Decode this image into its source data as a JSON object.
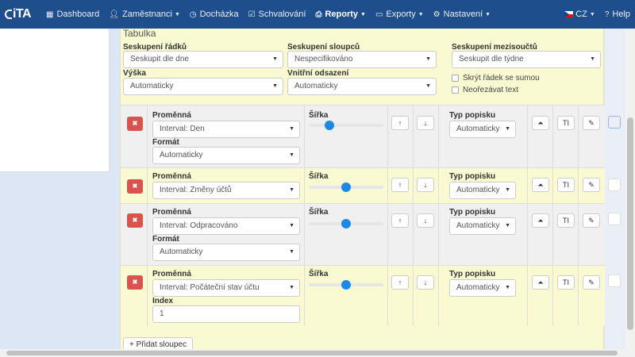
{
  "navbar": {
    "logo_text": "iTA",
    "items": [
      {
        "label": "Dashboard",
        "icon": "grid-icon"
      },
      {
        "label": "Zaměstnanci",
        "icon": "user-icon",
        "dropdown": true
      },
      {
        "label": "Docházka",
        "icon": "clock-icon"
      },
      {
        "label": "Schvalování",
        "icon": "check-square-icon"
      },
      {
        "label": "Reporty",
        "icon": "print-icon",
        "dropdown": true,
        "active": true
      },
      {
        "label": "Exporty",
        "icon": "folder-icon",
        "dropdown": true
      },
      {
        "label": "Nastavení",
        "icon": "gear-icon",
        "dropdown": true
      }
    ],
    "language": "CZ",
    "help": "Help"
  },
  "table_settings": {
    "section_title": "Tabulka",
    "row_grouping": {
      "label": "Seskupení řádků",
      "value": "Seskupit dle dne"
    },
    "column_grouping": {
      "label": "Seskupení sloupců",
      "value": "Nespecifikováno"
    },
    "subtotal_grouping": {
      "label": "Seskupení mezisoučtů",
      "value": "Seskupit dle týdne"
    },
    "height": {
      "label": "Výška",
      "value": "Automaticky"
    },
    "padding": {
      "label": "Vnitřní odsazení",
      "value": "Automaticky"
    },
    "hide_sum_row": "Skrýt řádek se sumou",
    "no_truncate": "Neořezávat text"
  },
  "columns": [
    {
      "variable_label": "Proměnná",
      "variable_value": "Interval: Den",
      "extra_label": "Formát",
      "extra_value": "Automaticky",
      "extra_type": "select",
      "width_label": "Šířka",
      "width_value": 0.28,
      "caption_label": "Typ popisku",
      "caption_value": "Automaticky"
    },
    {
      "variable_label": "Proměnná",
      "variable_value": "Interval: Změny účtů",
      "width_label": "Šířka",
      "width_value": 0.5,
      "caption_label": "Typ popisku",
      "caption_value": "Automaticky"
    },
    {
      "variable_label": "Proměnná",
      "variable_value": "Interval: Odpracováno",
      "extra_label": "Formát",
      "extra_value": "Automaticky",
      "extra_type": "select",
      "width_label": "Šířka",
      "width_value": 0.5,
      "caption_label": "Typ popisku",
      "caption_value": "Automaticky"
    },
    {
      "variable_label": "Proměnná",
      "variable_value": "Interval: Počáteční stav účtu",
      "extra_label": "Index",
      "extra_value": "1",
      "extra_type": "input",
      "width_label": "Šířka",
      "width_value": 0.5,
      "caption_label": "Typ popisku",
      "caption_value": "Automaticky"
    }
  ],
  "add_column_label": "Přidat sloupec"
}
